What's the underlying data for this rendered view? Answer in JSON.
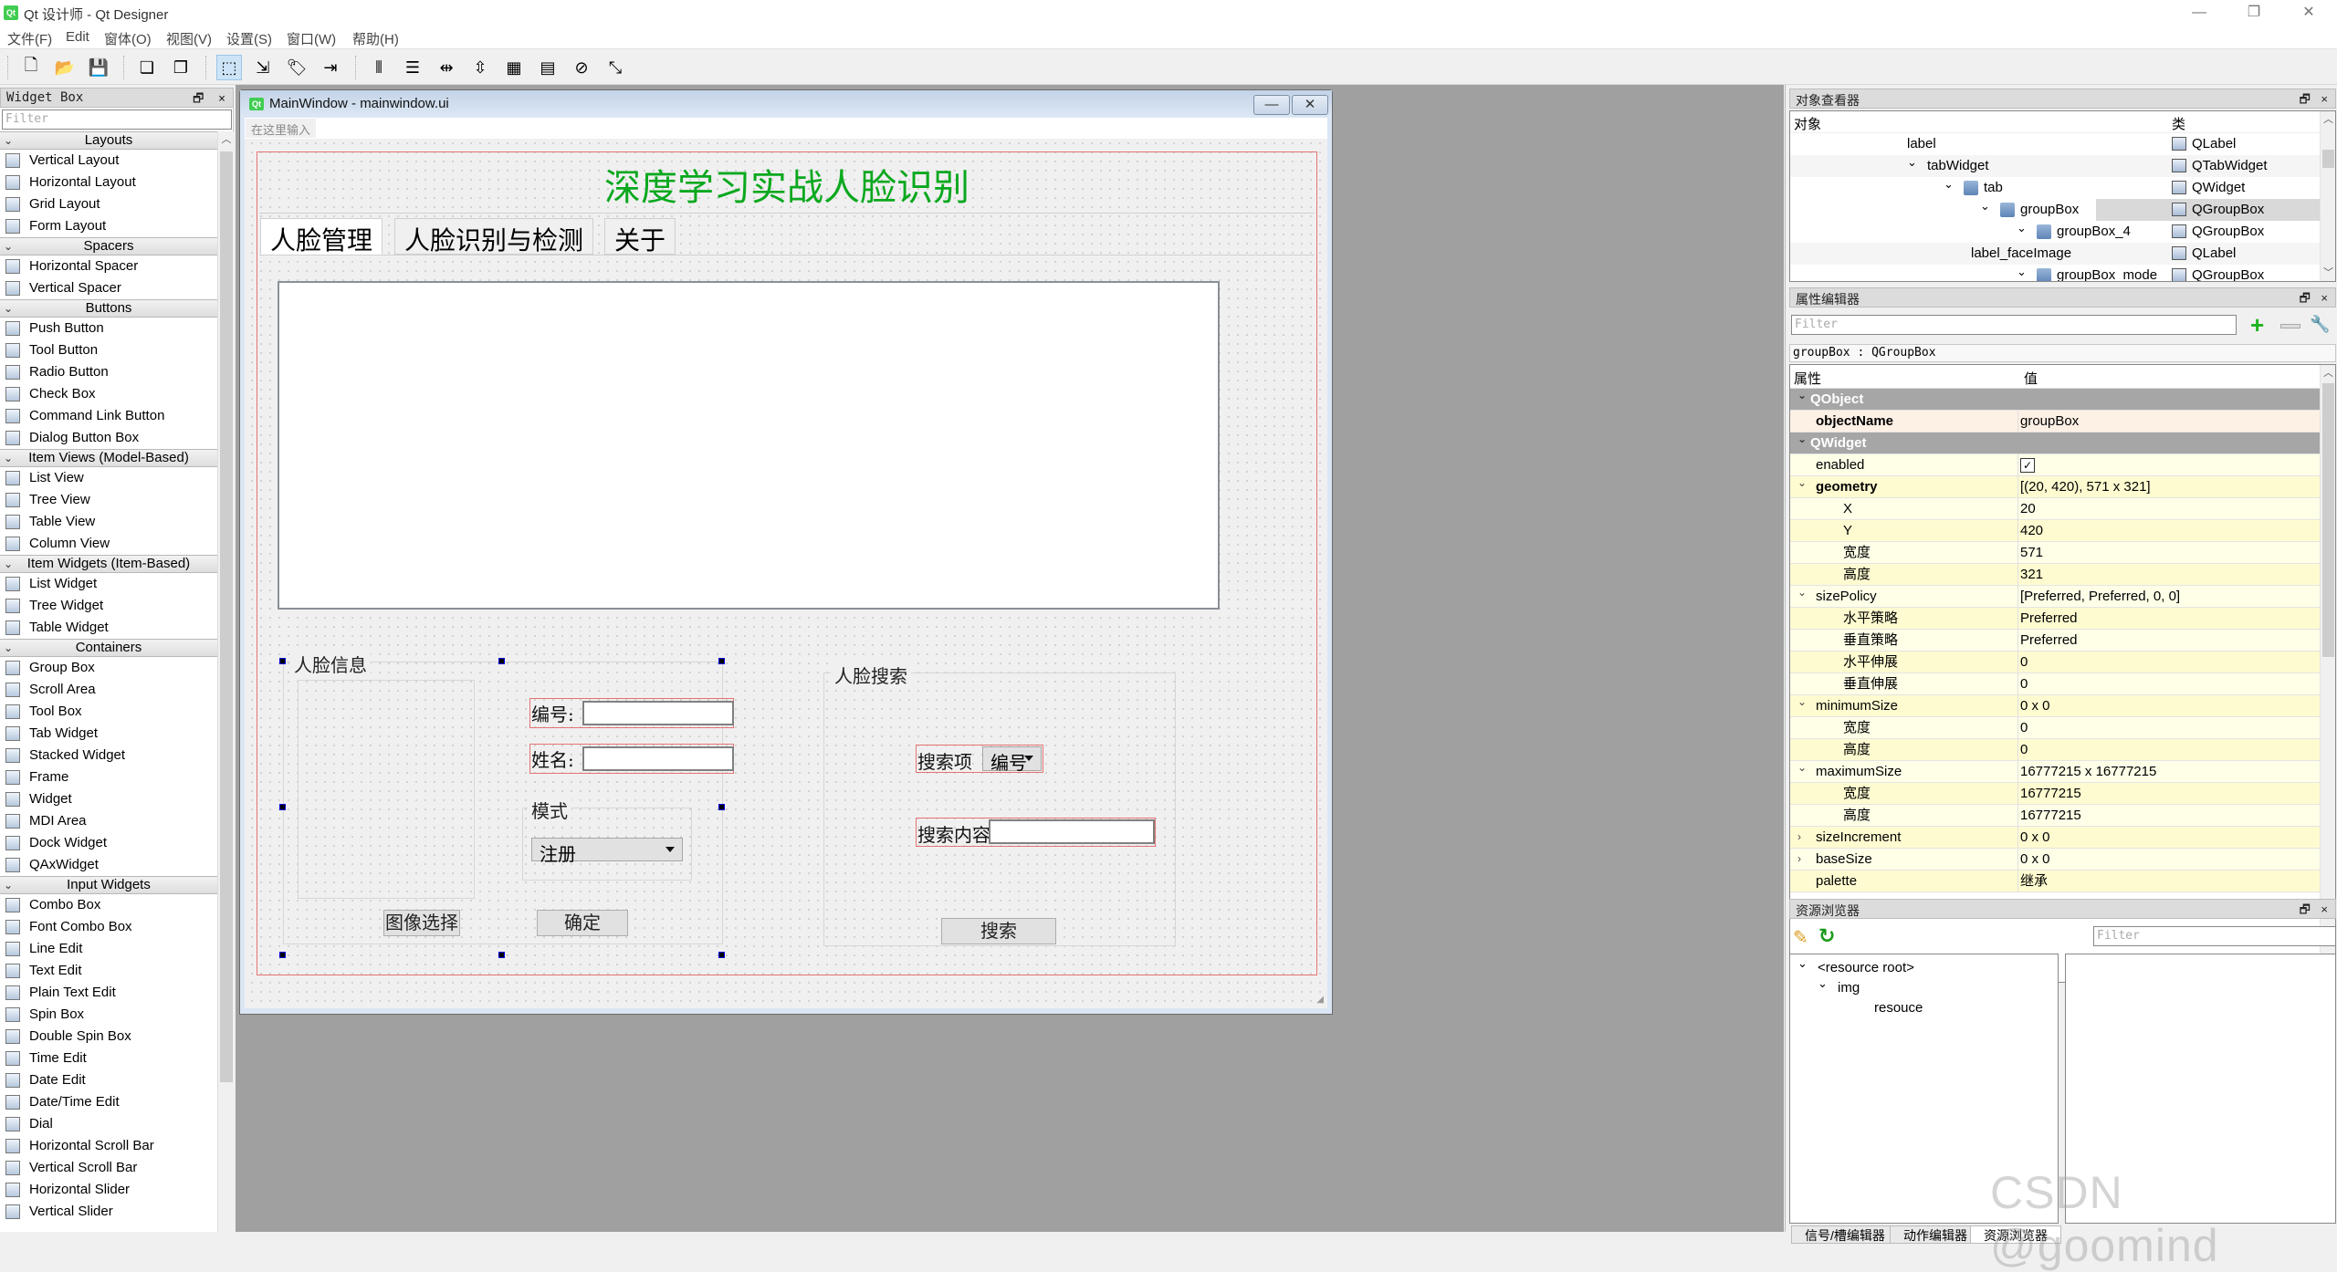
{
  "app": {
    "title": "Qt 设计师 - Qt Designer",
    "logo": "Qt",
    "window_controls": {
      "minimize": "—",
      "restore": "❐",
      "close": "✕"
    }
  },
  "menubar": [
    "文件(F)",
    "Edit",
    "窗体(O)",
    "视图(V)",
    "设置(S)",
    "窗口(W)",
    "帮助(H)"
  ],
  "toolbar": {
    "groups": [
      [
        {
          "icon": "new-file-icon",
          "glyph": "🗋"
        },
        {
          "icon": "open-folder-icon",
          "glyph": "📂"
        },
        {
          "icon": "save-icon",
          "glyph": "💾"
        }
      ],
      [
        {
          "icon": "send-to-back-icon",
          "glyph": "❏"
        },
        {
          "icon": "bring-to-front-icon",
          "glyph": "❐"
        }
      ],
      [
        {
          "icon": "edit-widgets-icon",
          "glyph": "⬚",
          "active": true
        },
        {
          "icon": "edit-signals-slots-icon",
          "glyph": "⇲"
        },
        {
          "icon": "edit-buddies-icon",
          "glyph": "🏷"
        },
        {
          "icon": "edit-tab-order-icon",
          "glyph": "⇥"
        }
      ],
      [
        {
          "icon": "lay-out-horizontally-icon",
          "glyph": "⫴"
        },
        {
          "icon": "lay-out-vertically-icon",
          "glyph": "☰"
        },
        {
          "icon": "horizontal-splitter-icon",
          "glyph": "⇹"
        },
        {
          "icon": "vertical-splitter-icon",
          "glyph": "⇳"
        },
        {
          "icon": "grid-layout-icon",
          "glyph": "▦"
        },
        {
          "icon": "form-layout-icon",
          "glyph": "▤"
        },
        {
          "icon": "break-layout-icon",
          "glyph": "⊘"
        },
        {
          "icon": "adjust-size-icon",
          "glyph": "⤡"
        }
      ]
    ]
  },
  "widget_box": {
    "title": "Widget Box",
    "dock_controls": "🗗 ×",
    "filter_placeholder": "Filter",
    "categories": [
      {
        "name": "Layouts",
        "items": [
          "Vertical Layout",
          "Horizontal Layout",
          "Grid Layout",
          "Form Layout"
        ]
      },
      {
        "name": "Spacers",
        "items": [
          "Horizontal Spacer",
          "Vertical Spacer"
        ]
      },
      {
        "name": "Buttons",
        "items": [
          "Push Button",
          "Tool Button",
          "Radio Button",
          "Check Box",
          "Command Link Button",
          "Dialog Button Box"
        ]
      },
      {
        "name": "Item Views (Model-Based)",
        "items": [
          "List View",
          "Tree View",
          "Table View",
          "Column View"
        ]
      },
      {
        "name": "Item Widgets (Item-Based)",
        "items": [
          "List Widget",
          "Tree Widget",
          "Table Widget"
        ]
      },
      {
        "name": "Containers",
        "items": [
          "Group Box",
          "Scroll Area",
          "Tool Box",
          "Tab Widget",
          "Stacked Widget",
          "Frame",
          "Widget",
          "MDI Area",
          "Dock Widget",
          "QAxWidget"
        ]
      },
      {
        "name": "Input Widgets",
        "items": [
          "Combo Box",
          "Font Combo Box",
          "Line Edit",
          "Text Edit",
          "Plain Text Edit",
          "Spin Box",
          "Double Spin Box",
          "Time Edit",
          "Date Edit",
          "Date/Time Edit",
          "Dial",
          "Horizontal Scroll Bar",
          "Vertical Scroll Bar",
          "Horizontal Slider",
          "Vertical Slider"
        ]
      }
    ]
  },
  "form_window": {
    "title": "MainWindow - mainwindow.ui",
    "logo": "Qt",
    "minimize": "—",
    "close": "✕",
    "menu_placeholder": "在这里输入",
    "main_title": "深度学习实战人脸识别",
    "title_color": "#0aa81e",
    "tabs": [
      "人脸管理",
      "人脸识别与检测",
      "关于"
    ],
    "active_tab": 0,
    "face_info": {
      "title": "人脸信息",
      "id_label": "编号:",
      "id_value": "",
      "name_label": "姓名:",
      "name_value": "",
      "mode_title": "模式",
      "mode_value": "注册",
      "select_image_button": "图像选择",
      "confirm_button": "确定"
    },
    "face_search": {
      "title": "人脸搜索",
      "item_label": "搜索项",
      "item_value": "编号",
      "content_label": "搜索内容",
      "content_value": "",
      "search_button": "搜索"
    }
  },
  "object_inspector": {
    "title": "对象查看器",
    "dock_controls": "🗗 ×",
    "columns": [
      "对象",
      "类"
    ],
    "rows": [
      {
        "name": "label",
        "class": "QLabel",
        "depth": 3,
        "expanded": null
      },
      {
        "name": "tabWidget",
        "class": "QTabWidget",
        "depth": 2,
        "expanded": true
      },
      {
        "name": "tab",
        "class": "QWidget",
        "depth": 3,
        "expanded": true
      },
      {
        "name": "groupBox",
        "class": "QGroupBox",
        "depth": 4,
        "expanded": true,
        "selected": true
      },
      {
        "name": "groupBox_4",
        "class": "QGroupBox",
        "depth": 5,
        "expanded": true
      },
      {
        "name": "label_faceImage",
        "class": "QLabel",
        "depth": 6,
        "expanded": null
      },
      {
        "name": "groupBox_mode",
        "class": "QGroupBox",
        "depth": 5,
        "expanded": true
      }
    ]
  },
  "property_editor": {
    "title": "属性编辑器",
    "dock_controls": "🗗 ×",
    "filter_placeholder": "Filter",
    "object_class": "groupBox : QGroupBox",
    "columns": [
      "属性",
      "值"
    ],
    "rows": [
      {
        "type": "group",
        "key": "QObject"
      },
      {
        "type": "prop",
        "key": "objectName",
        "value": "groupBox",
        "bold": true,
        "style": "sel"
      },
      {
        "type": "group",
        "key": "QWidget"
      },
      {
        "type": "prop",
        "key": "enabled",
        "value": "✓",
        "checkbox": true,
        "style": "y2"
      },
      {
        "type": "prop",
        "key": "geometry",
        "value": "[(20, 420), 571 x 321]",
        "bold": true,
        "exp": "open",
        "style": "y1"
      },
      {
        "type": "sub",
        "key": "X",
        "value": "20",
        "style": "y2"
      },
      {
        "type": "sub",
        "key": "Y",
        "value": "420",
        "style": "y1"
      },
      {
        "type": "sub",
        "key": "宽度",
        "value": "571",
        "style": "y2"
      },
      {
        "type": "sub",
        "key": "高度",
        "value": "321",
        "style": "y1"
      },
      {
        "type": "prop",
        "key": "sizePolicy",
        "value": "[Preferred, Preferred, 0, 0]",
        "exp": "open",
        "style": "y2"
      },
      {
        "type": "sub",
        "key": "水平策略",
        "value": "Preferred",
        "style": "y1"
      },
      {
        "type": "sub",
        "key": "垂直策略",
        "value": "Preferred",
        "style": "y2"
      },
      {
        "type": "sub",
        "key": "水平伸展",
        "value": "0",
        "style": "y1"
      },
      {
        "type": "sub",
        "key": "垂直伸展",
        "value": "0",
        "style": "y2"
      },
      {
        "type": "prop",
        "key": "minimumSize",
        "value": "0 x 0",
        "exp": "open",
        "style": "y1"
      },
      {
        "type": "sub",
        "key": "宽度",
        "value": "0",
        "style": "y2"
      },
      {
        "type": "sub",
        "key": "高度",
        "value": "0",
        "style": "y1"
      },
      {
        "type": "prop",
        "key": "maximumSize",
        "value": "16777215 x 16777215",
        "exp": "open",
        "style": "y2"
      },
      {
        "type": "sub",
        "key": "宽度",
        "value": "16777215",
        "style": "y1"
      },
      {
        "type": "sub",
        "key": "高度",
        "value": "16777215",
        "style": "y2"
      },
      {
        "type": "prop",
        "key": "sizeIncrement",
        "value": "0 x 0",
        "exp": "closed",
        "style": "y1"
      },
      {
        "type": "prop",
        "key": "baseSize",
        "value": "0 x 0",
        "exp": "closed",
        "style": "y2"
      },
      {
        "type": "prop",
        "key": "palette",
        "value": "继承",
        "style": "y1"
      }
    ]
  },
  "resource_browser": {
    "title": "资源浏览器",
    "dock_controls": "🗗 ×",
    "filter_placeholder": "Filter",
    "tree": [
      {
        "label": "<resource root>",
        "depth": 0,
        "expanded": true
      },
      {
        "label": "img",
        "depth": 1,
        "expanded": true
      },
      {
        "label": "resouce",
        "depth": 2,
        "expanded": null
      }
    ]
  },
  "bottom_tabs": [
    "信号/槽编辑器",
    "动作编辑器",
    "资源浏览器"
  ],
  "active_bottom_tab": 2,
  "watermark": "CSDN @goomind"
}
